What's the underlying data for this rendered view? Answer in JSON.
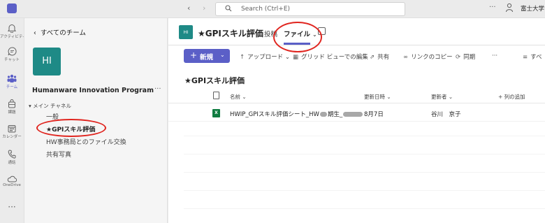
{
  "topbar": {
    "search_placeholder": "Search (Ctrl+E)",
    "more": "···",
    "org_name": "富士大学"
  },
  "rail": {
    "items": [
      {
        "label": "アクティビティ",
        "icon": "bell-icon"
      },
      {
        "label": "チャット",
        "icon": "chat-icon"
      },
      {
        "label": "チーム",
        "icon": "teams-icon"
      },
      {
        "label": "課題",
        "icon": "assignments-icon"
      },
      {
        "label": "カレンダー",
        "icon": "calendar-icon"
      },
      {
        "label": "通話",
        "icon": "phone-icon"
      },
      {
        "label": "OneDrive",
        "icon": "cloud-icon"
      }
    ],
    "more": "···"
  },
  "teampanel": {
    "back_label": "すべてのチーム",
    "avatar_initials": "HI",
    "team_name": "Humanware Innovation Program",
    "team_more": "···",
    "section_label": "メイン チャネル",
    "channels": [
      "一般",
      "★GPIスキル評価",
      "HW事務局とのファイル交換",
      "共有写真"
    ]
  },
  "channel": {
    "avatar_initials": "HI",
    "title": "★GPIスキル評価",
    "tabs": {
      "posts": "投稿",
      "files": "ファイル"
    }
  },
  "toolbar": {
    "new_label": "新規",
    "upload": "アップロード",
    "grid_edit": "グリッド ビューでの編集",
    "share": "共有",
    "copy_link": "リンクのコピー",
    "sync": "同期",
    "more": "···",
    "all": "すべ"
  },
  "library": {
    "title": "★GPIスキル評価",
    "columns": {
      "name": "名前",
      "modified": "更新日時",
      "modified_by": "更新者",
      "add_column": "列の追加"
    },
    "files": [
      {
        "name_prefix": "HWIP_GPIスキル評価シート_HW",
        "name_mid": "期生_",
        "modified": "8月7日",
        "modified_by": "谷川　京子",
        "type": "excel"
      }
    ]
  },
  "colors": {
    "brand": "#5b5fc7",
    "team_avatar": "#1e8a86",
    "annotation": "#e0251f",
    "excel": "#107c41"
  }
}
